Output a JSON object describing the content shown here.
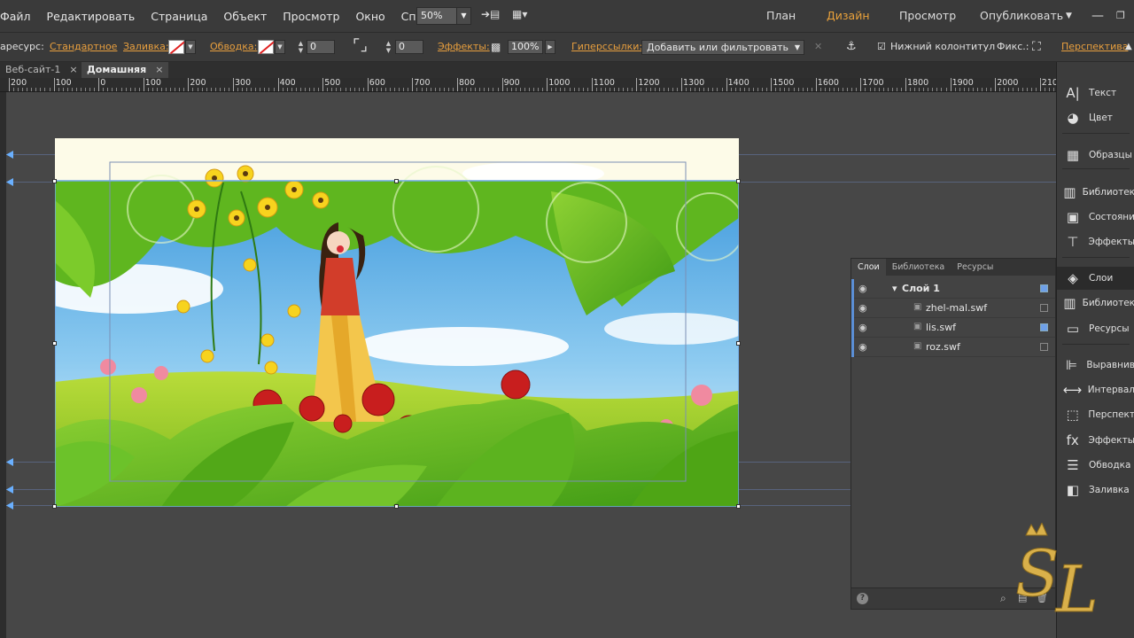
{
  "menu": [
    "Файл",
    "Редактировать",
    "Страница",
    "Объект",
    "Просмотр",
    "Окно",
    "Справка"
  ],
  "zoom": "50%",
  "workspaces": {
    "plan": "План",
    "design": "Дизайн",
    "preview": "Просмотр",
    "publish": "Опубликовать"
  },
  "options": {
    "resource_label": "аресурс:",
    "resource_value": "Стандартное",
    "fill_label": "Заливка:",
    "stroke_label": "Обводка:",
    "stroke_value": "0",
    "corner_value": "0",
    "effects_label": "Эффекты:",
    "opacity": "100%",
    "hyperlinks_label": "Гиперссылки:",
    "hyperlinks_value": "Добавить или фильтровать",
    "footer_label": "Нижний колонтитул",
    "fix_label": "Фикс.:",
    "perspective_label": "Перспектива"
  },
  "doc_tabs": [
    {
      "label": "Веб-сайт-1"
    },
    {
      "label": "Домашняя"
    }
  ],
  "ruler_labels": [
    "200",
    "100",
    "0",
    "100",
    "200",
    "300",
    "400",
    "500",
    "600",
    "700",
    "800",
    "900",
    "1000",
    "1100",
    "1200",
    "1300",
    "1400",
    "1500",
    "1600",
    "1700",
    "1800",
    "1900",
    "2000",
    "210"
  ],
  "dock": [
    {
      "label": "Текст",
      "icon": "text-icon"
    },
    {
      "label": "Цвет",
      "icon": "color-icon"
    },
    {
      "label": "Образцы",
      "icon": "swatches-icon"
    },
    {
      "label": "Библиотек",
      "icon": "library-icon"
    },
    {
      "label": "Состояни",
      "icon": "states-icon"
    },
    {
      "label": "Эффекты",
      "icon": "effects-icon"
    },
    {
      "label": "Слои",
      "icon": "layers-icon"
    },
    {
      "label": "Библиотек",
      "icon": "library-icon"
    },
    {
      "label": "Ресурсы",
      "icon": "resources-icon"
    },
    {
      "label": "Выравнив",
      "icon": "align-icon"
    },
    {
      "label": "Интервал",
      "icon": "spacing-icon"
    },
    {
      "label": "Перспект",
      "icon": "perspective-icon"
    },
    {
      "label": "Эффекты",
      "icon": "fx-icon"
    },
    {
      "label": "Обводка",
      "icon": "stroke-icon"
    },
    {
      "label": "Заливка",
      "icon": "fill-icon"
    }
  ],
  "layers_panel": {
    "tabs": [
      "Слои",
      "Библиотека",
      "Ресурсы"
    ],
    "group": "Слой 1",
    "items": [
      "zhel-mal.swf",
      "lis.swf",
      "roz.swf"
    ]
  },
  "colors": {
    "accent": "#e89f3e",
    "selection": "#5b8fd6"
  }
}
